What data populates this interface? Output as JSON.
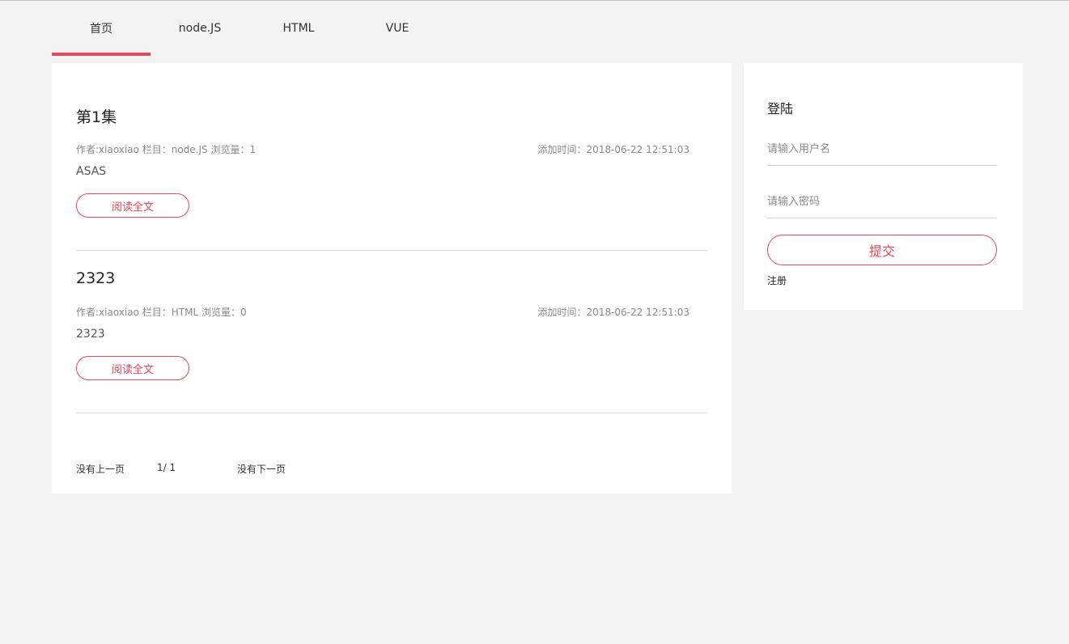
{
  "nav": {
    "items": [
      {
        "label": "首页",
        "active": true
      },
      {
        "label": "node.JS",
        "active": false
      },
      {
        "label": "HTML",
        "active": false
      },
      {
        "label": "VUE",
        "active": false
      }
    ]
  },
  "articles": [
    {
      "title": "第1集",
      "meta_left": "作者:xiaoxiao 栏目：node.JS 浏览量：1",
      "meta_right": "添加时间：2018-06-22 12:51:03",
      "summary": "ASAS",
      "read_label": "阅读全文"
    },
    {
      "title": "2323",
      "meta_left": "作者:xiaoxiao 栏目：HTML 浏览量：0",
      "meta_right": "添加时间：2018-06-22 12:51:03",
      "summary": "2323",
      "read_label": "阅读全文"
    }
  ],
  "pager": {
    "prev": "没有上一页",
    "page": "1/ 1",
    "next": "没有下一页"
  },
  "login": {
    "title": "登陆",
    "username_placeholder": "请输入用户名",
    "password_placeholder": "请输入密码",
    "submit_label": "提交",
    "register_label": "注册"
  },
  "colors": {
    "accent": "#e8475c",
    "background": "#f3f3f3",
    "panel": "#ffffff"
  }
}
